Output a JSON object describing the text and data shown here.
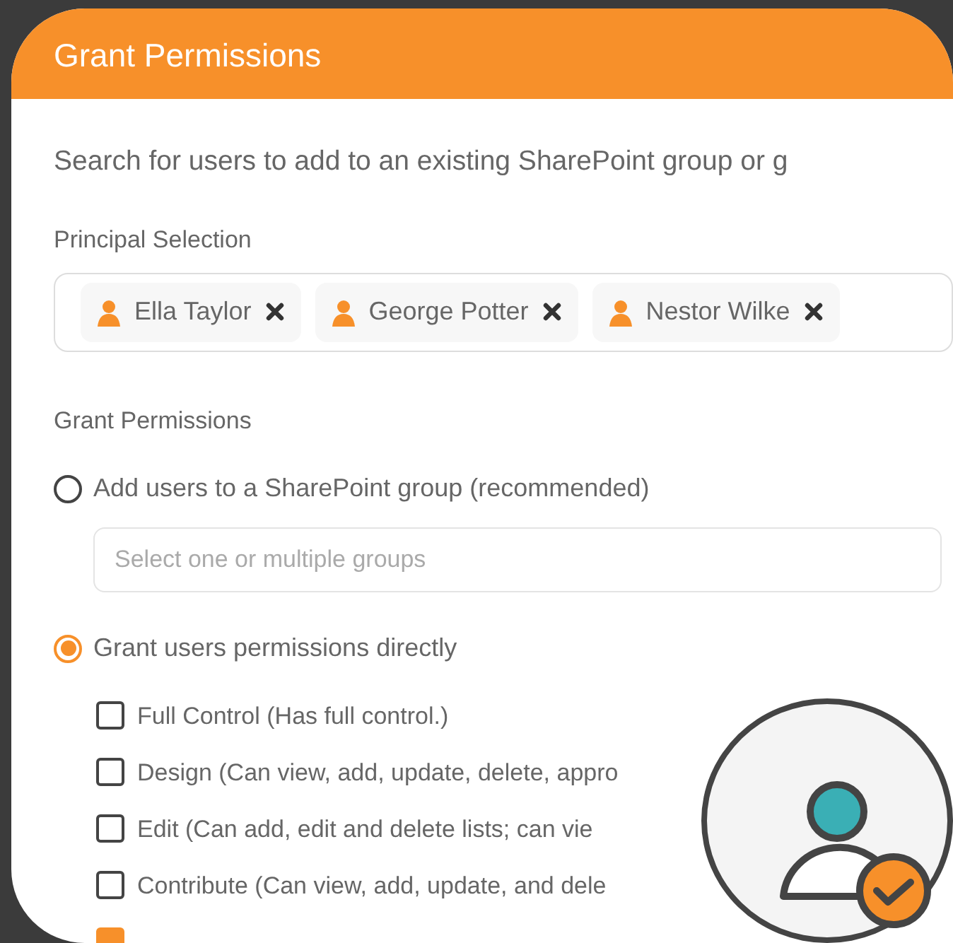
{
  "dialog": {
    "title": "Grant Permissions",
    "description": "Search for users to add to an existing SharePoint group or g",
    "principal_selection": {
      "label": "Principal Selection",
      "chips": [
        {
          "name": "Ella Taylor"
        },
        {
          "name": "George Potter"
        },
        {
          "name": "Nestor Wilke"
        }
      ]
    },
    "grant_permissions": {
      "label": "Grant Permissions",
      "options": [
        {
          "label": "Add users to a SharePoint group (recommended)",
          "selected": false,
          "field": {
            "placeholder": "Select one or multiple groups"
          }
        },
        {
          "label": "Grant users permissions directly",
          "selected": true,
          "permissions": [
            {
              "label": "Full Control (Has full control.)",
              "checked": false
            },
            {
              "label": "Design (Can view, add, update, delete, appro",
              "checked": false
            },
            {
              "label": "Edit (Can add, edit and delete lists; can vie",
              "checked": false
            },
            {
              "label": "Contribute (Can view, add, update, and dele",
              "checked": false
            },
            {
              "checked": true
            }
          ]
        }
      ]
    }
  }
}
